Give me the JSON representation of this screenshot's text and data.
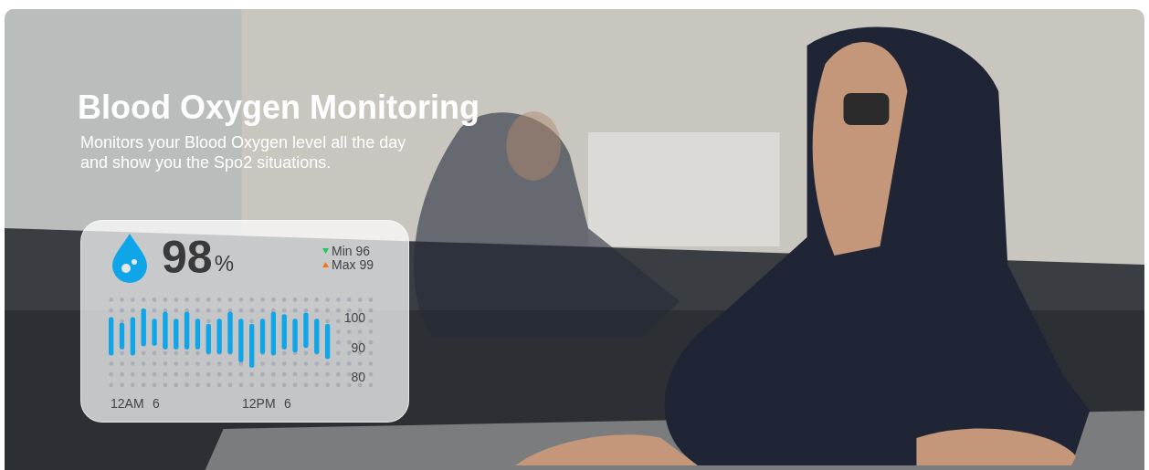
{
  "banner": {
    "title": "Blood Oxygen Monitoring",
    "subtitle": "Monitors your Blood Oxygen level all the day\nand show you the Spo2 situations."
  },
  "card": {
    "value": "98",
    "unit": "%",
    "min": {
      "label": "Min 96",
      "color": "#22c55e"
    },
    "max": {
      "label": "Max 99",
      "color": "#f97316"
    },
    "y_ticks": [
      "100",
      "90",
      "80"
    ],
    "x_labels": [
      "12AM",
      "6",
      "12PM",
      "6"
    ]
  }
}
